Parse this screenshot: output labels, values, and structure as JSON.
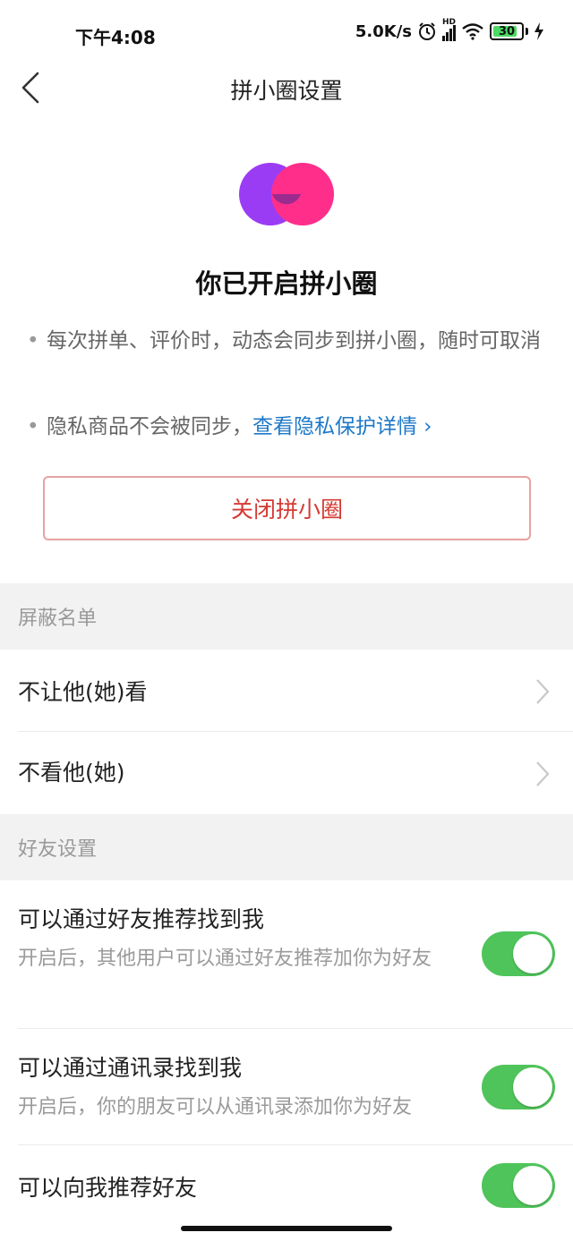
{
  "status_bar": {
    "time": "下午4:08",
    "net_speed": "5.0K/s",
    "hd_label": "HD",
    "battery_level": "30"
  },
  "nav": {
    "title": "拼小圈设置"
  },
  "hero": {
    "title": "你已开启拼小圈",
    "bullet_1": "每次拼单、评价时，动态会同步到拼小圈，随时可取消",
    "bullet_2_prefix": "隐私商品不会被同步，",
    "bullet_2_link": "查看隐私保护详情 ›",
    "close_button": "关闭拼小圈"
  },
  "block_list": {
    "header": "屏蔽名单",
    "items": [
      {
        "label": "不让他(她)看"
      },
      {
        "label": "不看他(她)"
      }
    ]
  },
  "friend_settings": {
    "header": "好友设置",
    "items": [
      {
        "label": "可以通过好友推荐找到我",
        "desc": "开启后，其他用户可以通过好友推荐加你为好友",
        "enabled": true
      },
      {
        "label": "可以通过通讯录找到我",
        "desc": "开启后，你的朋友可以从通讯录添加你为好友",
        "enabled": true
      },
      {
        "label": "可以向我推荐好友",
        "desc": "",
        "enabled": true
      }
    ]
  },
  "colors": {
    "accent_red": "#d43a32",
    "link_blue": "#1e78c8",
    "toggle_green": "#4fc45a",
    "logo_purple": "#9b3cf5",
    "logo_pink": "#ff2e8a"
  }
}
